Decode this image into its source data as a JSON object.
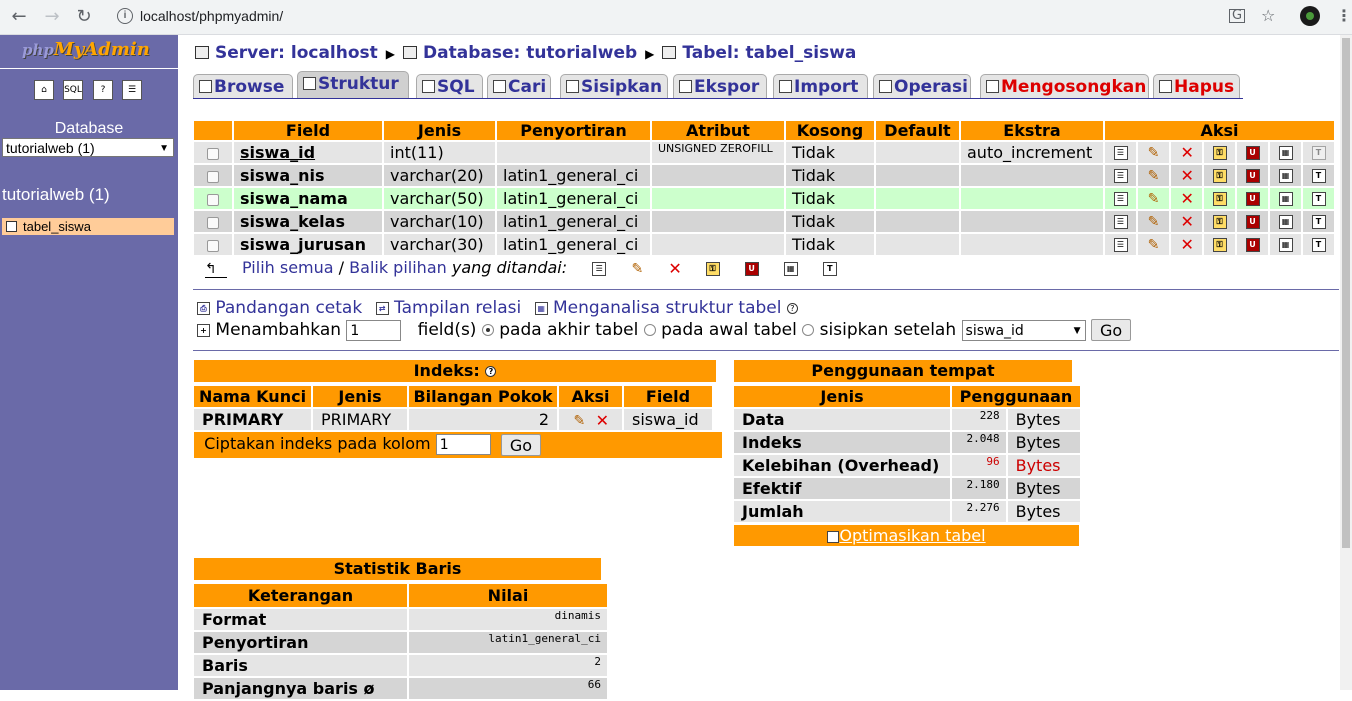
{
  "browser": {
    "url": "localhost/phpmyadmin/",
    "back_icon": "arrow-left",
    "forward_icon": "arrow-right",
    "reload_icon": "reload",
    "info_icon": "info",
    "translate_icon": "translate",
    "star_icon": "star",
    "menu_icon": "kebab"
  },
  "sidebar": {
    "logo_php": "php",
    "logo_admin": "MyAdmin",
    "database_label": "Database",
    "database_select": "tutorialweb (1)",
    "db_heading": "tutorialweb (1)",
    "table_item": "tabel_siswa"
  },
  "breadcrumb": {
    "server": "Server: localhost",
    "database": "Database: tutorialweb",
    "table": "Tabel: tabel_siswa"
  },
  "tabs": [
    {
      "label": "Browse"
    },
    {
      "label": "Struktur"
    },
    {
      "label": "SQL"
    },
    {
      "label": "Cari"
    },
    {
      "label": "Sisipkan"
    },
    {
      "label": "Ekspor"
    },
    {
      "label": "Import"
    },
    {
      "label": "Operasi"
    },
    {
      "label": "Mengosongkan"
    },
    {
      "label": "Hapus"
    }
  ],
  "structure": {
    "headers": [
      "Field",
      "Jenis",
      "Penyortiran",
      "Atribut",
      "Kosong",
      "Default",
      "Ekstra",
      "Aksi"
    ],
    "rows": [
      {
        "field": "siswa_id",
        "type": "int(11)",
        "collation": "",
        "attribute": "UNSIGNED ZEROFILL",
        "null": "Tidak",
        "default": "",
        "extra": "auto_increment"
      },
      {
        "field": "siswa_nis",
        "type": "varchar(20)",
        "collation": "latin1_general_ci",
        "attribute": "",
        "null": "Tidak",
        "default": "",
        "extra": ""
      },
      {
        "field": "siswa_nama",
        "type": "varchar(50)",
        "collation": "latin1_general_ci",
        "attribute": "",
        "null": "Tidak",
        "default": "",
        "extra": ""
      },
      {
        "field": "siswa_kelas",
        "type": "varchar(10)",
        "collation": "latin1_general_ci",
        "attribute": "",
        "null": "Tidak",
        "default": "",
        "extra": ""
      },
      {
        "field": "siswa_jurusan",
        "type": "varchar(30)",
        "collation": "latin1_general_ci",
        "attribute": "",
        "null": "Tidak",
        "default": "",
        "extra": ""
      }
    ],
    "check_all": "Pilih semua",
    "separator": "/",
    "uncheck_all": "Balik pilihan",
    "with_selected": "yang ditandai:"
  },
  "links": {
    "print_view": "Pandangan cetak",
    "relation_view": "Tampilan relasi",
    "propose_structure": "Menganalisa struktur tabel"
  },
  "add_field": {
    "label": "Menambahkan",
    "value": "1",
    "fields_label": "field(s)",
    "at_end": "pada akhir tabel",
    "at_beginning": "pada awal tabel",
    "after": "sisipkan setelah",
    "after_select": "siswa_id",
    "go": "Go"
  },
  "indexes": {
    "title": "Indeks:",
    "headers": [
      "Nama Kunci",
      "Jenis",
      "Bilangan Pokok",
      "Aksi",
      "Field"
    ],
    "rows": [
      {
        "name": "PRIMARY",
        "type": "PRIMARY",
        "cardinality": "2",
        "field": "siswa_id"
      }
    ],
    "create_label": "Ciptakan indeks pada kolom",
    "create_value": "1",
    "go": "Go"
  },
  "space": {
    "title": "Penggunaan tempat",
    "headers": [
      "Jenis",
      "Penggunaan"
    ],
    "rows": [
      {
        "label": "Data",
        "value": "228",
        "unit": "Bytes"
      },
      {
        "label": "Indeks",
        "value": "2.048",
        "unit": "Bytes"
      },
      {
        "label": "Kelebihan (Overhead)",
        "value": "96",
        "unit": "Bytes"
      },
      {
        "label": "Efektif",
        "value": "2.180",
        "unit": "Bytes"
      },
      {
        "label": "Jumlah",
        "value": "2.276",
        "unit": "Bytes"
      }
    ],
    "optimize": "Optimasikan tabel"
  },
  "stats": {
    "title": "Statistik Baris",
    "headers": [
      "Keterangan",
      "Nilai"
    ],
    "rows": [
      {
        "label": "Format",
        "value": "dinamis"
      },
      {
        "label": "Penyortiran",
        "value": "latin1_general_ci"
      },
      {
        "label": "Baris",
        "value": "2"
      },
      {
        "label": "Panjangnya baris ø",
        "value": "66"
      }
    ]
  },
  "colors": {
    "header_orange": "#ff9900",
    "sidebar_purple": "#6a6aa8",
    "link_blue": "#333399",
    "row_highlight": "#ccffcc",
    "danger_red": "#dd0000"
  }
}
